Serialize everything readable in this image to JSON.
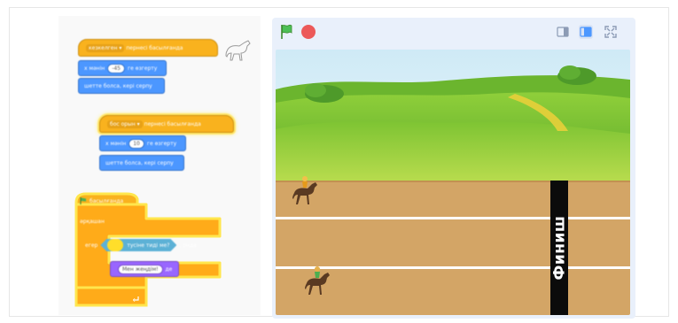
{
  "code": {
    "script1": {
      "hat_dropdown": "кезкелген ▾",
      "hat_text": "пернесі басылғанда",
      "motion_prefix": "х мәнін",
      "motion_value": "-45",
      "motion_suffix": "ге өзгерту",
      "bounce_text": "шетте болса, кері серпу"
    },
    "script2": {
      "hat_dropdown": "бос орын ▾",
      "hat_text": "пернесі басылғанда",
      "motion_prefix": "х мәнін",
      "motion_value": "10",
      "motion_suffix": "ге өзгерту",
      "bounce_text": "шетте болса, кері серпу"
    },
    "script3": {
      "hat_text": "басылғанда",
      "forever_text": "әрқашан",
      "if_prefix": "егер",
      "sensing_text": "тусіне тиді ме?",
      "if_suffix": ", онда",
      "say_value": "Мен жеңдім!",
      "say_suffix": "де"
    },
    "sprite_icon": "horse-sprite-icon"
  },
  "stage": {
    "finish_label": "Финиш",
    "green_flag_icon": "green-flag-icon",
    "stop_icon": "stop-icon",
    "header_icons": [
      "small-stage-icon",
      "large-stage-icon",
      "fullscreen-icon"
    ]
  },
  "colors": {
    "events": "#f9b21e",
    "motion": "#4c97ff",
    "control": "#ffab19",
    "looks": "#9966ff",
    "sensing": "#5cb1d6",
    "track": "#d3a566"
  }
}
